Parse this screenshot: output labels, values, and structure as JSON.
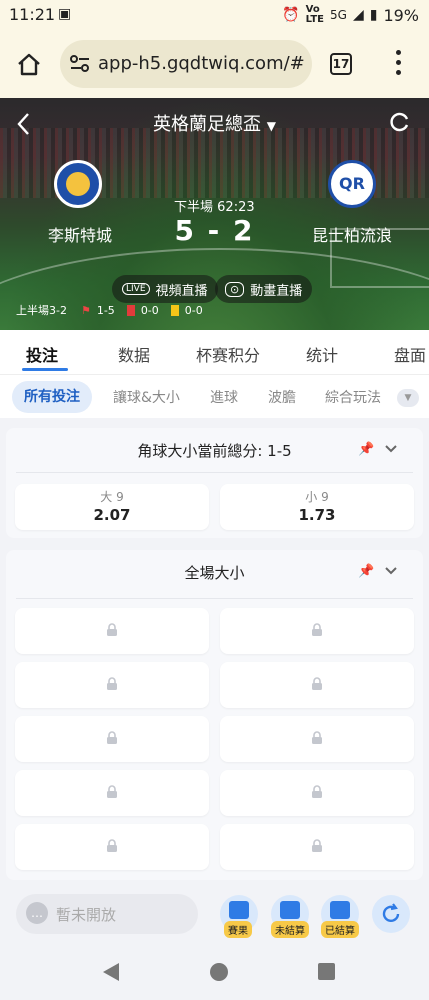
{
  "status_bar": {
    "time": "11:21",
    "battery": "19%",
    "network": "5G"
  },
  "browser": {
    "url": "app-h5.gqdtwiq.com/#",
    "tab_count": "17"
  },
  "match": {
    "league_title": "英格蘭足總盃",
    "home_team": "李斯特城",
    "away_team": "昆士柏流浪",
    "period": "下半場",
    "clock": "62:23",
    "score": "5 - 2",
    "video_live_label": "視頻直播",
    "animation_live_label": "動畫直播",
    "live_badge": "LIVE",
    "half_time_label": "上半場3-2",
    "corners": "1-5",
    "red_cards": "0-0",
    "yellow_cards": "0-0"
  },
  "main_tabs": [
    "投注",
    "数据",
    "杯赛积分",
    "统计",
    "盘面"
  ],
  "sub_tabs": [
    "所有投注",
    "讓球&大小",
    "進球",
    "波膽",
    "綜合玩法"
  ],
  "market1": {
    "title": "角球大小當前總分: 1-5",
    "options": [
      {
        "label": "大 9",
        "odds": "2.07"
      },
      {
        "label": "小 9",
        "odds": "1.73"
      }
    ]
  },
  "market2": {
    "title": "全場大小",
    "locked_rows": 5
  },
  "bottom": {
    "chat_placeholder": "暫未開放",
    "results_label": "賽果",
    "unsettled_label": "未結算",
    "settled_label": "已結算"
  },
  "colors": {
    "accent": "#2f7be5",
    "badge": "#f7c948"
  }
}
